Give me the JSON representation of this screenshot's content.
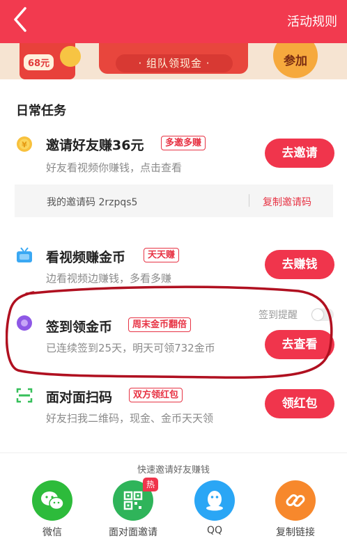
{
  "header": {
    "rules_label": "活动规则"
  },
  "banner": {
    "amount": "68元",
    "subtitle": "· 组队领现金 ·",
    "join_label": "参加"
  },
  "section_title": "日常任务",
  "tasks": [
    {
      "title": "邀请好友赚36元",
      "tag": "多邀多赚",
      "sub": "好友看视频你赚钱，点击查看",
      "button": "去邀请"
    },
    {
      "title": "看视频赚金币",
      "tag": "天天赚",
      "sub": "边看视频边赚钱，多看多赚",
      "button": "去赚钱"
    },
    {
      "title": "签到领金币",
      "tag": "周末金币翻倍",
      "sub": "已连续签到25天，明天可领732金币",
      "button": "去查看"
    },
    {
      "title": "面对面扫码",
      "tag": "双方领红包",
      "sub": "好友扫我二维码，现金、金币天天领",
      "button": "领红包"
    }
  ],
  "invite": {
    "code_text": "我的邀请码 2rzpqs5",
    "copy_label": "复制邀请码"
  },
  "signin_remind": {
    "label": "签到提醒",
    "enabled": false
  },
  "share": {
    "title": "快速邀请好友赚钱",
    "hot_badge": "热",
    "items": [
      {
        "label": "微信",
        "icon": "wechat-icon",
        "color": "#2dbb3b"
      },
      {
        "label": "面对面邀请",
        "icon": "qrcode-icon",
        "color": "#2fb45a"
      },
      {
        "label": "QQ",
        "icon": "qq-icon",
        "color": "#2aa6f5"
      },
      {
        "label": "复制链接",
        "icon": "link-icon",
        "color": "#f7882c"
      }
    ]
  },
  "colors": {
    "brand_red": "#f0354c",
    "topbar": "#f23a4f",
    "highlight_ring": "#b01020"
  }
}
